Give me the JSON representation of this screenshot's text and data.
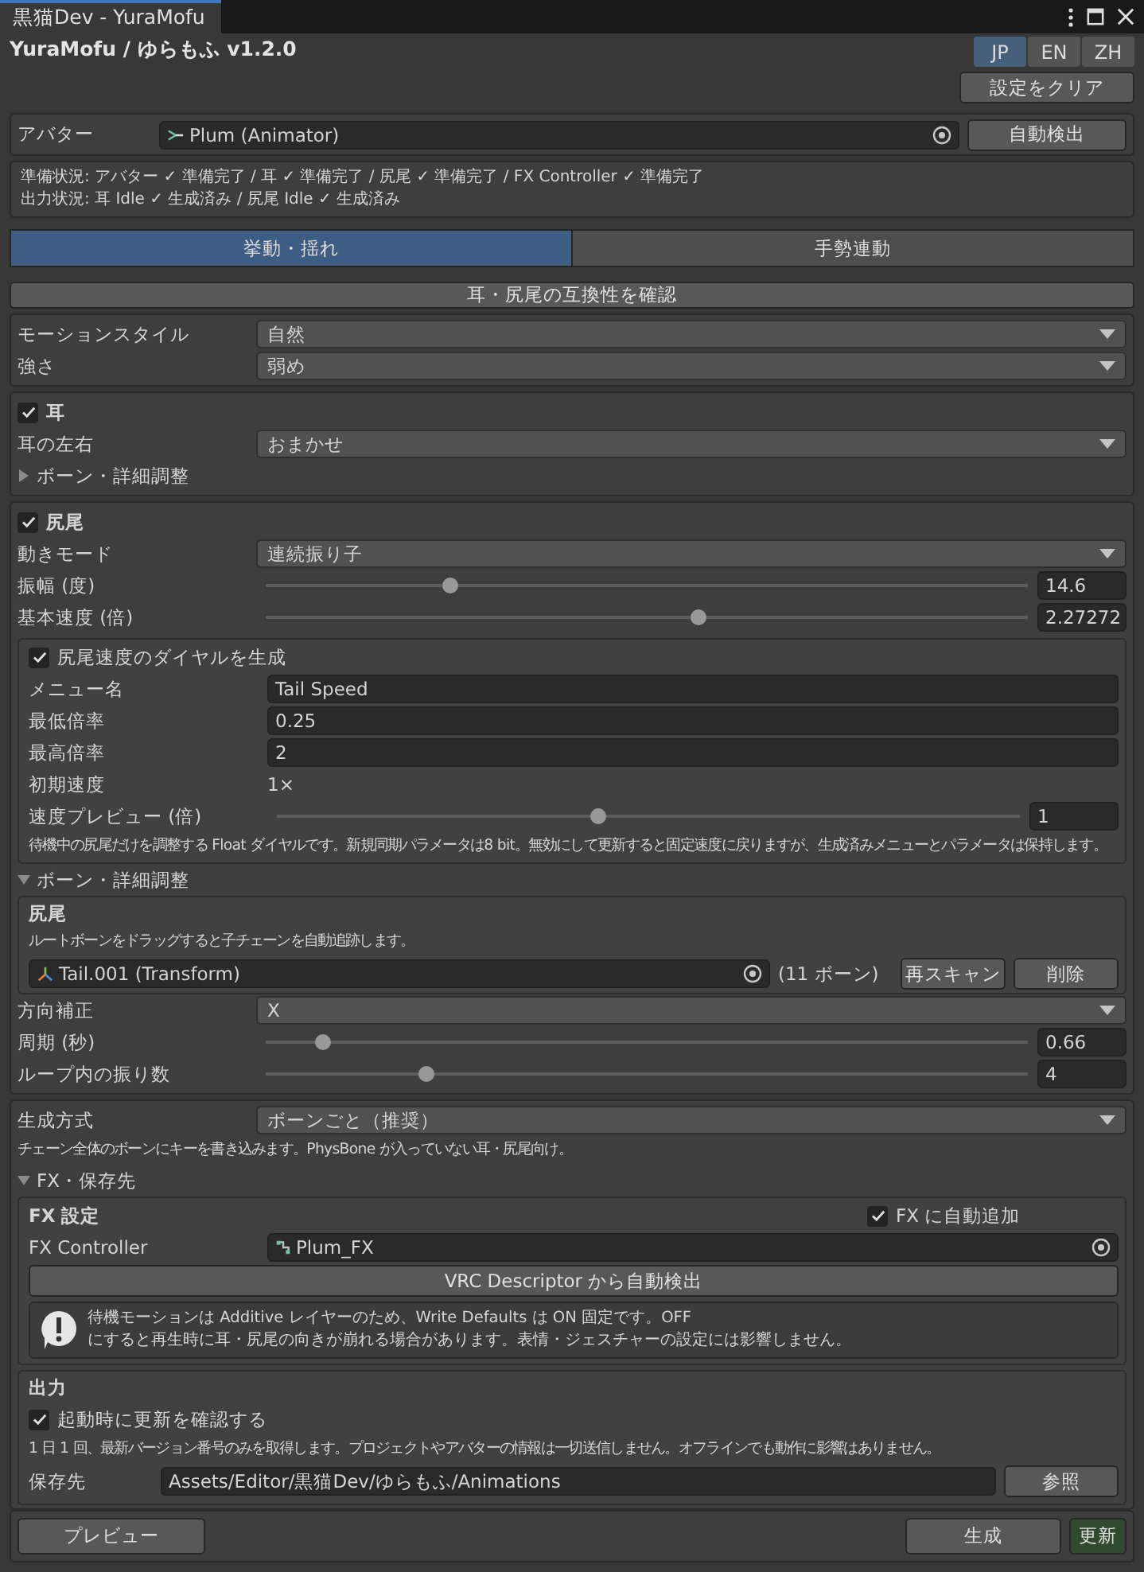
{
  "window": {
    "title": "黒猫Dev - YuraMofu"
  },
  "header": {
    "title": "YuraMofu / ゆらもふ v1.2.0",
    "clear_button": "設定をクリア",
    "languages": [
      {
        "label": "JP",
        "selected": true
      },
      {
        "label": "EN",
        "selected": false
      },
      {
        "label": "ZH",
        "selected": false
      }
    ]
  },
  "avatar": {
    "label": "アバター",
    "value": "Plum (Animator)",
    "button": "自動検出"
  },
  "status": {
    "lines": [
      "準備状況: アバター ✓ 準備完了  /  耳 ✓ 準備完了  /  尻尾 ✓ 準備完了  /  FX Controller ✓ 準備完了",
      "出力状況: 耳 Idle ✓ 生成済み  /  尻尾 Idle ✓ 生成済み"
    ]
  },
  "tabs": [
    {
      "label": "挙動・揺れ",
      "selected": true
    },
    {
      "label": "手勢連動",
      "selected": false
    }
  ],
  "compat_button": "耳・尻尾の互換性を確認",
  "motion": {
    "rows": [
      {
        "kind": "dropdown",
        "label": "モーションスタイル",
        "value": "自然"
      },
      {
        "kind": "dropdown",
        "label": "強さ",
        "value": "弱め"
      }
    ]
  },
  "ear": {
    "label": "耳",
    "checked": true,
    "rows": [
      {
        "kind": "dropdown",
        "label": "耳の左右",
        "value": "おまかせ"
      }
    ],
    "foldout": {
      "label": "ボーン・詳細調整",
      "expanded": false
    }
  },
  "tail": {
    "label": "尻尾",
    "checked": true,
    "rows": [
      {
        "kind": "dropdown",
        "label": "動きモード",
        "value": "連続振り子"
      },
      {
        "kind": "slider",
        "label": "振幅 (度)",
        "value": "14.6",
        "level": 0.236
      },
      {
        "kind": "slider",
        "label": "基本速度 (倍)",
        "value": "2.27272",
        "level": 0.57
      }
    ],
    "dial": {
      "label": "尻尾速度のダイヤルを生成",
      "checked": true,
      "rows": [
        {
          "kind": "text",
          "label": "メニュー名",
          "value": "Tail Speed"
        },
        {
          "kind": "text",
          "label": "最低倍率",
          "value": "0.25"
        },
        {
          "kind": "text",
          "label": "最高倍率",
          "value": "2"
        },
        {
          "kind": "readonly",
          "label": "初期速度",
          "value": "1×"
        },
        {
          "kind": "slider",
          "label": "速度プレビュー (倍)",
          "value": "1",
          "level": 0.43
        }
      ],
      "note": "待機中の尻尾だけを調整する Float ダイヤルです。新規同期パラメータは8 bit。無効にして更新すると固定速度に戻りますが、生成済みメニューとパラメータは保持します。"
    },
    "foldout": {
      "label": "ボーン・詳細調整",
      "expanded": true
    },
    "chain": {
      "title": "尻尾",
      "hint": "ルートボーンをドラッグすると子チェーンを自動追跡します。",
      "bone": "Tail.001 (Transform)",
      "count": "(11 ボーン)",
      "buttons": [
        "再スキャン",
        "削除"
      ]
    },
    "detail_rows": [
      {
        "kind": "dropdown",
        "label": "方向補正",
        "value": "X"
      },
      {
        "kind": "slider",
        "label": "周期 (秒)",
        "value": "0.66",
        "level": 0.066
      },
      {
        "kind": "slider",
        "label": "ループ内の振り数",
        "value": "4",
        "level": 0.205
      }
    ]
  },
  "generation": {
    "rows": [
      {
        "kind": "dropdown",
        "label": "生成方式",
        "value": "ボーンごと（推奨）"
      }
    ],
    "note": "チェーン全体のボーンにキーを書き込みます。PhysBone が入っていない耳・尻尾向け。",
    "foldout": {
      "label": "FX・保存先",
      "expanded": true
    },
    "fx": {
      "title": "FX 設定",
      "auto_add": {
        "label": "FX に自動追加",
        "checked": true
      },
      "controller_label": "FX Controller",
      "controller": "Plum_FX",
      "detect_button": "VRC Descriptor から自動検出",
      "warning": [
        "待機モーションは Additive レイヤーのため、Write Defaults は ON 固定です。OFF",
        "にすると再生時に耳・尻尾の向きが崩れる場合があります。表情・ジェスチャーの設定には影響しません。"
      ]
    },
    "output": {
      "title": "出力",
      "update_check": {
        "label": "起動時に更新を確認する",
        "checked": true
      },
      "note": "1 日 1 回、最新バージョン番号のみを取得します。プロジェクトやアバターの情報は一切送信しません。オフラインでも動作に影響はありません。",
      "save_label": "保存先",
      "save_path": "Assets/Editor/黒猫Dev/ゆらもふ/Animations",
      "browse_button": "参照"
    }
  },
  "footer": {
    "preview": "プレビュー",
    "generate": "生成",
    "update": "更新"
  }
}
